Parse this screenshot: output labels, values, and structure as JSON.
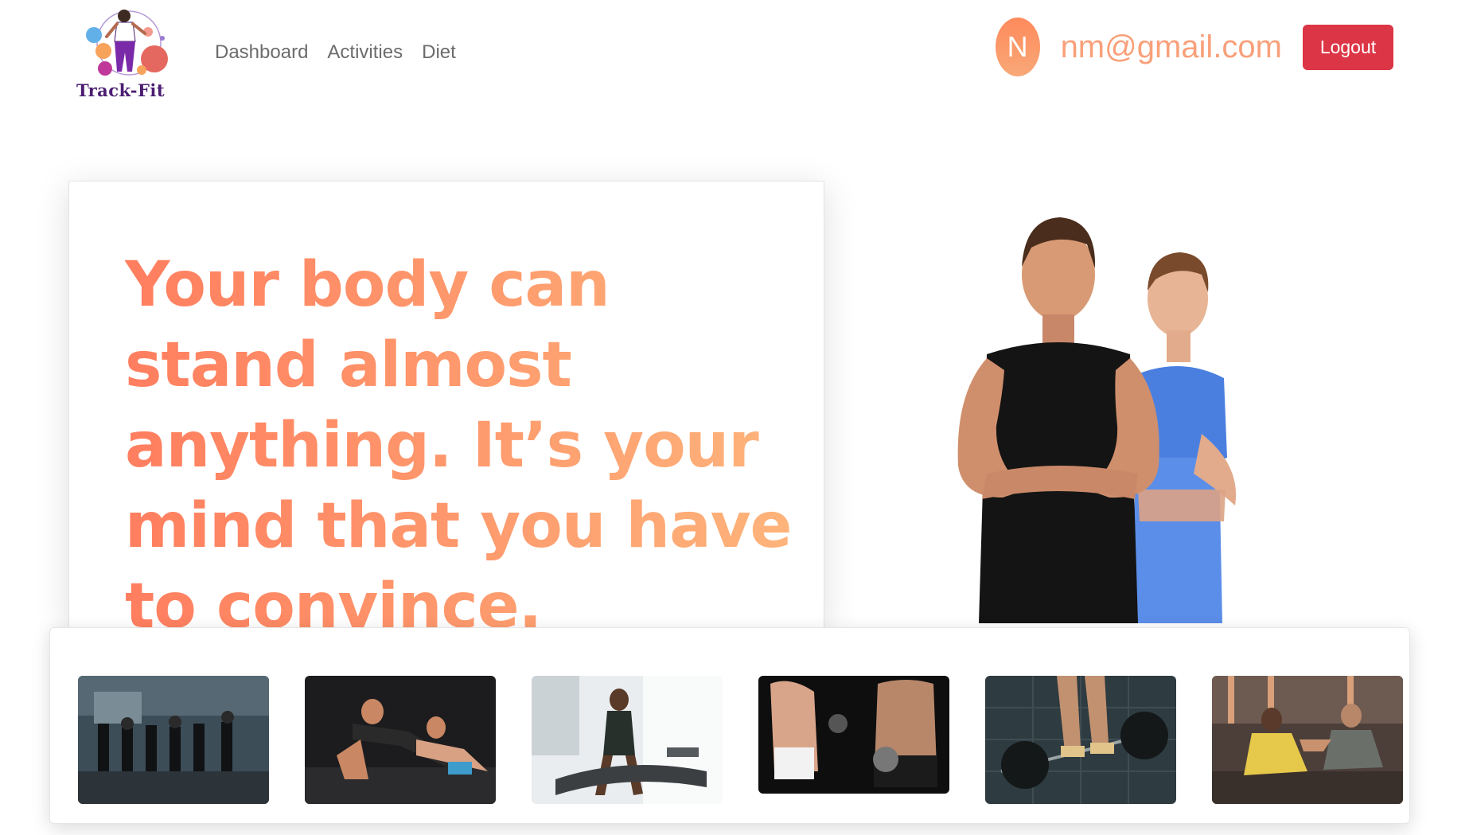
{
  "brand": {
    "name": "Track-Fit"
  },
  "nav": {
    "items": [
      {
        "label": "Dashboard"
      },
      {
        "label": "Activities"
      },
      {
        "label": "Diet"
      }
    ]
  },
  "user": {
    "initial": "N",
    "email": "nm@gmail.com",
    "logout_label": "Logout"
  },
  "hero": {
    "quote": "Your body can stand almost anything. It’s your mind that you have to convince."
  },
  "colors": {
    "accent_start": "#ff7e5f",
    "accent_end": "#feb47b",
    "logout": "#dc3545",
    "brand_purple": "#4b1d72"
  },
  "icons": {
    "logo": "fitness-runner-logo-icon"
  }
}
